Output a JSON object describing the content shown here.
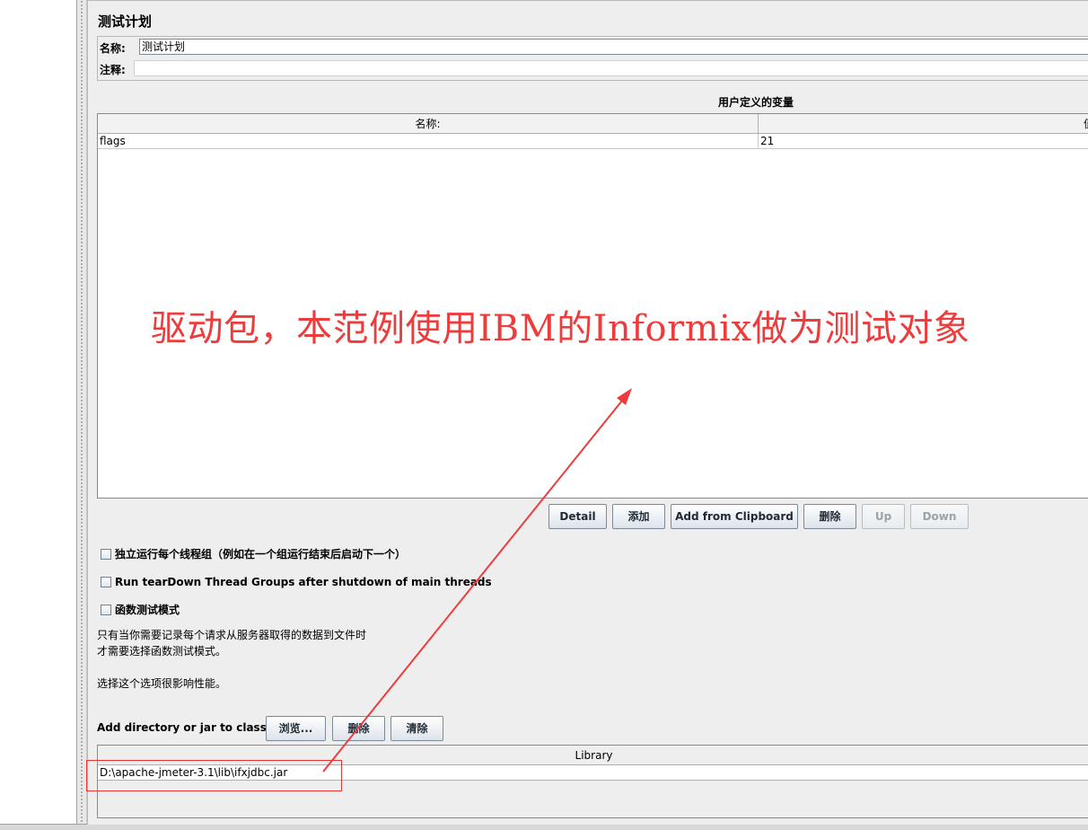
{
  "panel": {
    "title": "测试计划",
    "name_label": "名称:",
    "name_value": "测试计划",
    "comment_label": "注释:",
    "comment_value": ""
  },
  "variables": {
    "title": "用户定义的变量",
    "columns": [
      "名称:",
      "值"
    ],
    "rows": [
      {
        "name": "flags",
        "value": "21"
      }
    ]
  },
  "buttons": {
    "detail": "Detail",
    "add": "添加",
    "add_clipboard": "Add from Clipboard",
    "delete": "删除",
    "up": "Up",
    "down": "Down"
  },
  "options": {
    "run_groups_independently": "独立运行每个线程组（例如在一个组运行结束后启动下一个）",
    "run_teardown": "Run tearDown Thread Groups after shutdown of main threads",
    "functional_mode": "函数测试模式"
  },
  "hints": {
    "line1": "只有当你需要记录每个请求从服务器取得的数据到文件时",
    "line2": "才需要选择函数测试模式。",
    "line3": "选择这个选项很影响性能。"
  },
  "classpath": {
    "label": "Add directory or jar to classpath",
    "browse": "浏览...",
    "delete": "删除",
    "clear": "清除",
    "column": "Library",
    "entries": [
      "D:\\apache-jmeter-3.1\\lib\\ifxjdbc.jar"
    ]
  },
  "annotation": {
    "text": "驱动包，本范例使用IBM的Informix做为测试对象",
    "color": "#ee3b3b"
  }
}
